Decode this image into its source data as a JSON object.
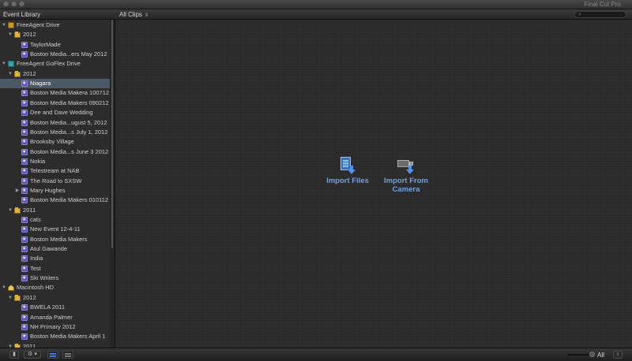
{
  "window": {
    "app_title": "Final Cut Pro"
  },
  "toolbar": {
    "library_title": "Event Library",
    "clips_filter": "All Clips"
  },
  "sidebar": {
    "rows": [
      {
        "type": "drive",
        "label": "FreeAgent Drive",
        "expanded": true,
        "level": 0
      },
      {
        "type": "year",
        "label": "2012",
        "expanded": true,
        "level": 1
      },
      {
        "type": "event",
        "label": "TaylorMade",
        "level": 2
      },
      {
        "type": "event",
        "label": "Boston Media...ers May 2012",
        "level": 2
      },
      {
        "type": "drive2",
        "label": "FreeAgent GoFlex Drive",
        "expanded": true,
        "level": 0
      },
      {
        "type": "year",
        "label": "2012",
        "expanded": true,
        "level": 1
      },
      {
        "type": "event",
        "label": "Niagara",
        "level": 2,
        "selected": true
      },
      {
        "type": "event",
        "label": "Boston Media Makera 100712",
        "level": 2
      },
      {
        "type": "event",
        "label": "Boston Media Makers 090212",
        "level": 2
      },
      {
        "type": "event",
        "label": "Dee and Dave Wedding",
        "level": 2
      },
      {
        "type": "event",
        "label": "Boston Media...ugust 5, 2012",
        "level": 2
      },
      {
        "type": "event",
        "label": "Boston Media...s July 1, 2012",
        "level": 2
      },
      {
        "type": "event",
        "label": "Brooksby Village",
        "level": 2
      },
      {
        "type": "event",
        "label": "Boston Media...s June 3 2012",
        "level": 2
      },
      {
        "type": "event",
        "label": "Nokia",
        "level": 2
      },
      {
        "type": "event",
        "label": "Telestream at NAB",
        "level": 2
      },
      {
        "type": "event",
        "label": "The Road to SXSW",
        "level": 2
      },
      {
        "type": "event",
        "label": "Mary Hughes",
        "level": 2,
        "collapsed": true
      },
      {
        "type": "event",
        "label": "Boston Media Makers 010112",
        "level": 2
      },
      {
        "type": "year",
        "label": "2011",
        "expanded": true,
        "level": 1
      },
      {
        "type": "event",
        "label": "cats",
        "level": 2
      },
      {
        "type": "event",
        "label": "New Event 12-4-11",
        "level": 2
      },
      {
        "type": "event",
        "label": "Boston Media Makers",
        "level": 2
      },
      {
        "type": "event",
        "label": "Atul Gawande",
        "level": 2
      },
      {
        "type": "event",
        "label": "India",
        "level": 2
      },
      {
        "type": "event",
        "label": "Test",
        "level": 2
      },
      {
        "type": "event",
        "label": "Ski Writers",
        "level": 2
      },
      {
        "type": "hd",
        "label": "Macintosh HD",
        "expanded": true,
        "level": 0
      },
      {
        "type": "year",
        "label": "2012",
        "expanded": true,
        "level": 1
      },
      {
        "type": "event",
        "label": "BWELA 2011",
        "level": 2
      },
      {
        "type": "event",
        "label": "Amanda Palmer",
        "level": 2
      },
      {
        "type": "event",
        "label": "NH Primary 2012",
        "level": 2
      },
      {
        "type": "event",
        "label": "Boston Media Makers April 1",
        "level": 2
      },
      {
        "type": "year",
        "label": "2011",
        "expanded": true,
        "level": 1
      }
    ]
  },
  "main": {
    "import_files": {
      "label": "Import Files"
    },
    "import_camera": {
      "label_line1": "Import From",
      "label_line2": "Camera"
    }
  },
  "bottombar": {
    "gear_label": "⚙ ▾",
    "filter_all": "All"
  },
  "colors": {
    "selection": "#4d5866",
    "accent": "#6fa3e8",
    "event_icon": "#5a52b0"
  },
  "icons": {
    "search": "search-icon",
    "event": "event-star-icon",
    "folder": "year-folder-icon",
    "drive": "drive-icon"
  }
}
